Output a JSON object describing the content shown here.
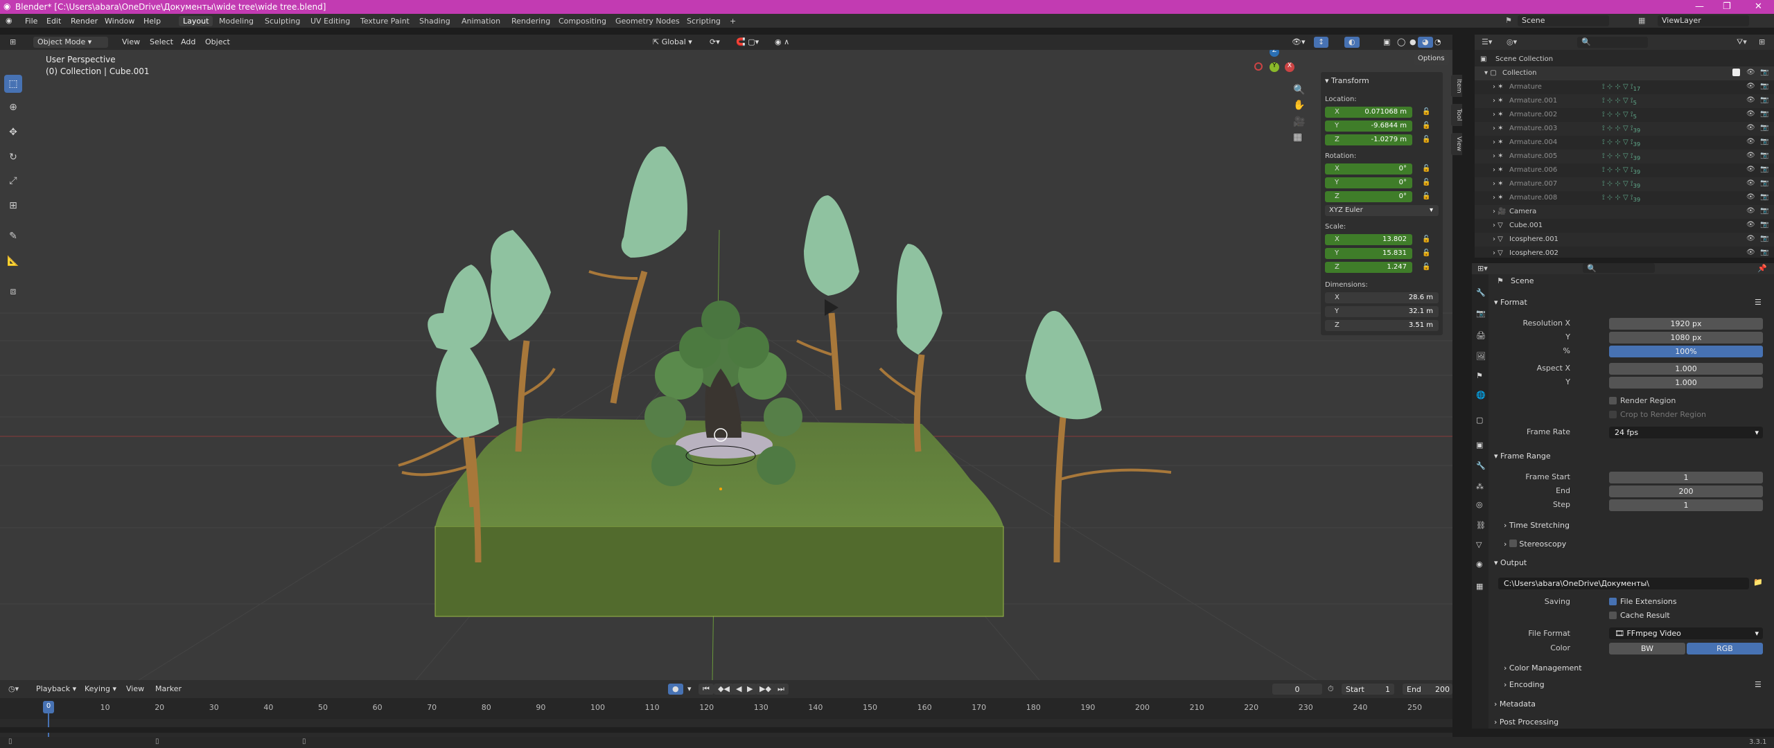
{
  "title": "Blender* [C:\\Users\\abara\\OneDrive\\Документы\\wide tree\\wide tree.blend]",
  "menu": [
    "File",
    "Edit",
    "Render",
    "Window",
    "Help"
  ],
  "workspaces": [
    "Layout",
    "Modeling",
    "Sculpting",
    "UV Editing",
    "Texture Paint",
    "Shading",
    "Animation",
    "Rendering",
    "Compositing",
    "Geometry Nodes",
    "Scripting"
  ],
  "active_workspace": "Layout",
  "scene_field": "Scene",
  "viewlayer_field": "ViewLayer",
  "viewport_header": {
    "mode": "Object Mode",
    "menus": [
      "View",
      "Select",
      "Add",
      "Object"
    ],
    "orientation": "Global",
    "options": "Options"
  },
  "viewport": {
    "perspective": "User Perspective",
    "selection_info": "(0) Collection | Cube.001",
    "tree_count": 9
  },
  "npanel": {
    "section": "Transform",
    "location_label": "Location:",
    "location": [
      [
        "X",
        "0.071068 m"
      ],
      [
        "Y",
        "-9.6844 m"
      ],
      [
        "Z",
        "-1.0279 m"
      ]
    ],
    "rotation_label": "Rotation:",
    "rotation": [
      [
        "X",
        "0°"
      ],
      [
        "Y",
        "0°"
      ],
      [
        "Z",
        "0°"
      ]
    ],
    "euler": "XYZ Euler",
    "scale_label": "Scale:",
    "scale": [
      [
        "X",
        "13.802"
      ],
      [
        "Y",
        "15.831"
      ],
      [
        "Z",
        "1.247"
      ]
    ],
    "dimensions_label": "Dimensions:",
    "dimensions": [
      [
        "X",
        "28.6 m"
      ],
      [
        "Y",
        "32.1 m"
      ],
      [
        "Z",
        "3.51 m"
      ]
    ],
    "tabs": [
      "Item",
      "Tool",
      "View"
    ]
  },
  "outliner": {
    "root": "Scene Collection",
    "collection": "Collection",
    "items": [
      {
        "name": "Armature",
        "badge": "17"
      },
      {
        "name": "Armature.001",
        "badge": "5"
      },
      {
        "name": "Armature.002",
        "badge": "5"
      },
      {
        "name": "Armature.003",
        "badge": "39"
      },
      {
        "name": "Armature.004",
        "badge": "39"
      },
      {
        "name": "Armature.005",
        "badge": "39"
      },
      {
        "name": "Armature.006",
        "badge": "39"
      },
      {
        "name": "Armature.007",
        "badge": "39"
      },
      {
        "name": "Armature.008",
        "badge": "39"
      },
      {
        "name": "Camera",
        "badge": ""
      },
      {
        "name": "Cube.001",
        "badge": ""
      },
      {
        "name": "Icosphere.001",
        "badge": ""
      },
      {
        "name": "Icosphere.002",
        "badge": ""
      }
    ]
  },
  "properties": {
    "context": "Scene",
    "format": {
      "header": "Format",
      "res_x_label": "Resolution X",
      "res_x": "1920 px",
      "res_y_label": "Y",
      "res_y": "1080 px",
      "pct_label": "%",
      "pct": "100%",
      "aspect_x_label": "Aspect X",
      "aspect_x": "1.000",
      "aspect_y_label": "Y",
      "aspect_y": "1.000",
      "render_region": "Render Region",
      "crop": "Crop to Render Region",
      "frame_rate_label": "Frame Rate",
      "frame_rate": "24 fps"
    },
    "frame_range": {
      "header": "Frame Range",
      "start_label": "Frame Start",
      "start": "1",
      "end_label": "End",
      "end": "200",
      "step_label": "Step",
      "step": "1"
    },
    "time_stretching": "Time Stretching",
    "stereoscopy": "Stereoscopy",
    "output": {
      "header": "Output",
      "path": "C:\\Users\\abara\\OneDrive\\Документы\\",
      "saving_label": "Saving",
      "file_ext": "File Extensions",
      "cache": "Cache Result",
      "file_format_label": "File Format",
      "file_format": "FFmpeg Video",
      "color_label": "Color",
      "color_bw": "BW",
      "color_rgb": "RGB"
    },
    "color_management": "Color Management",
    "encoding": "Encoding",
    "metadata": "Metadata",
    "post_processing": "Post Processing"
  },
  "timeline": {
    "menus": [
      "Playback",
      "Keying",
      "View",
      "Marker"
    ],
    "current_frame": "0",
    "start_label": "Start",
    "start": "1",
    "end_label": "End",
    "end": "200",
    "ticks": [
      "0",
      "10",
      "20",
      "30",
      "40",
      "50",
      "60",
      "70",
      "80",
      "90",
      "100",
      "110",
      "120",
      "130",
      "140",
      "150",
      "160",
      "170",
      "180",
      "190",
      "200",
      "210",
      "220",
      "230",
      "240",
      "250"
    ]
  },
  "version": "3.3.1"
}
